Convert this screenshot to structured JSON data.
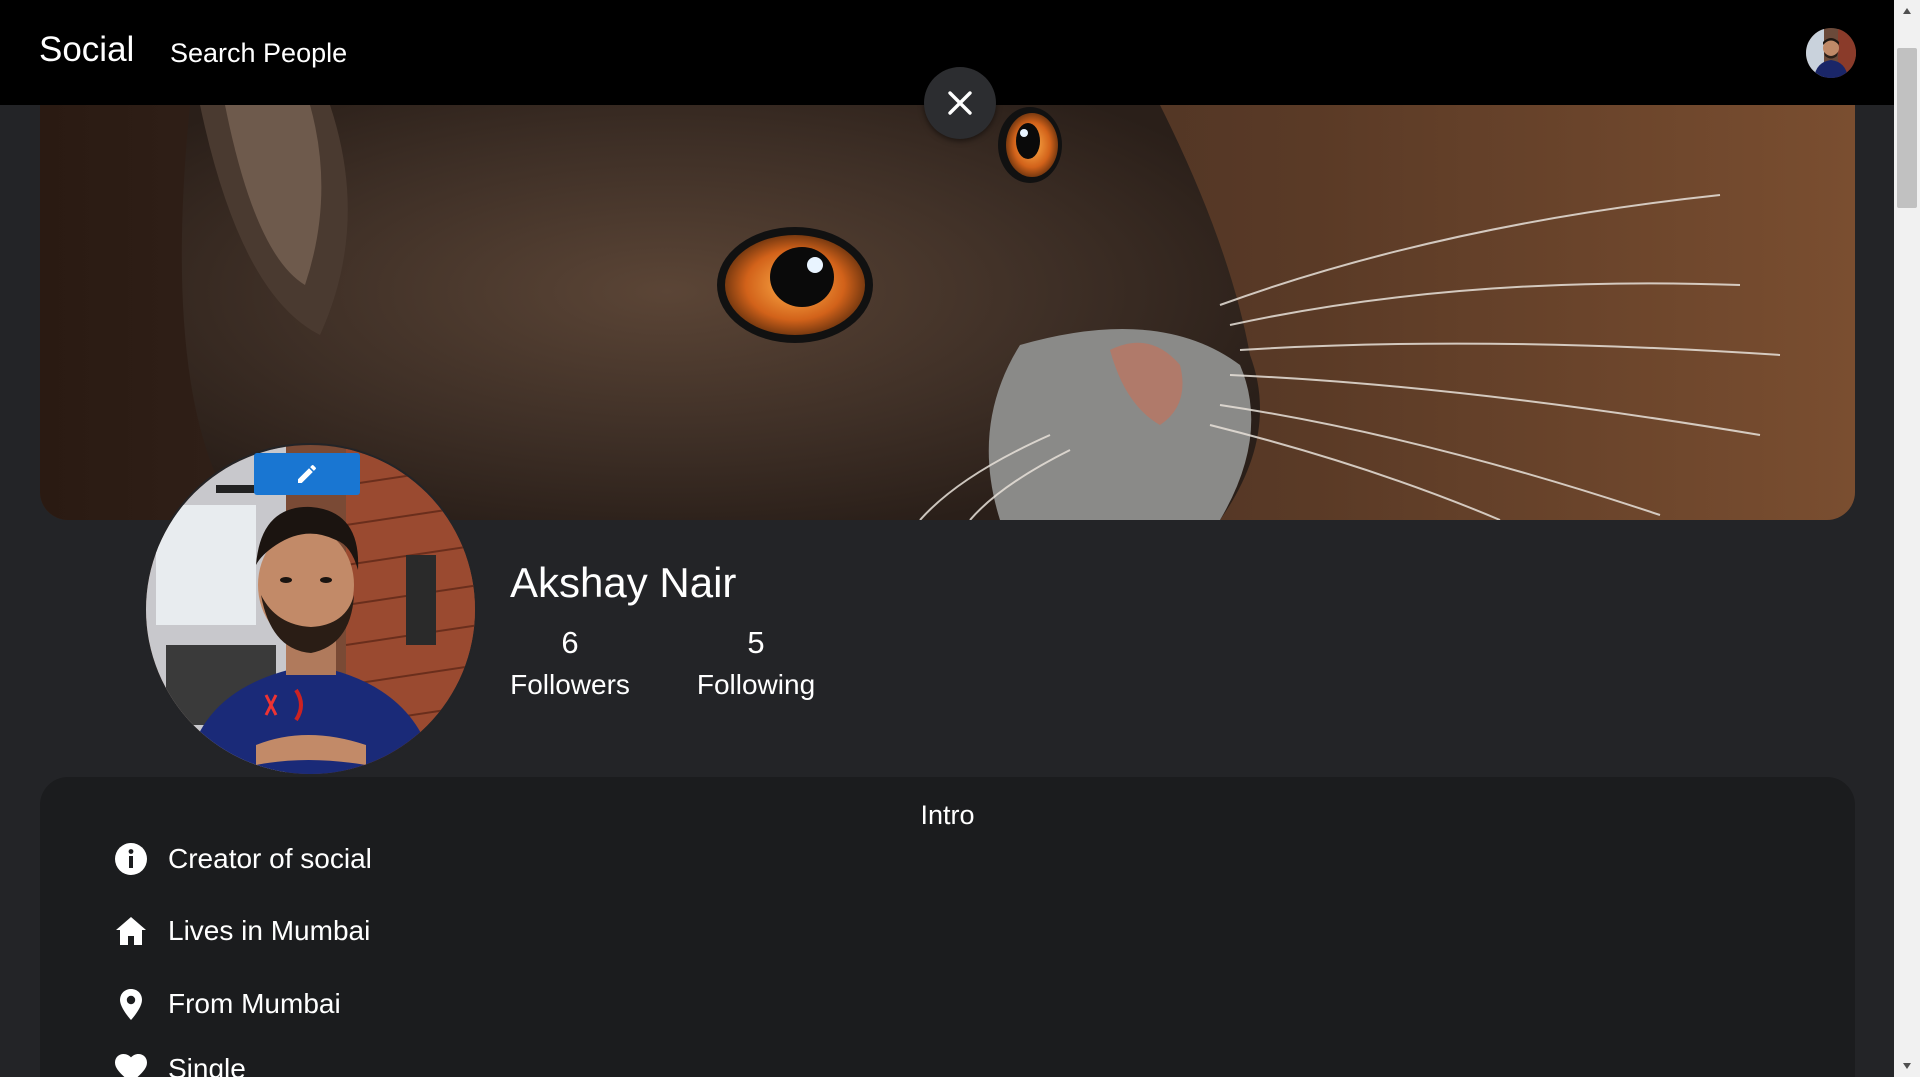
{
  "app": {
    "brand": "Social",
    "nav_search": "Search People"
  },
  "profile": {
    "name": "Akshay Nair",
    "followers_count": "6",
    "followers_label": "Followers",
    "following_count": "5",
    "following_label": "Following"
  },
  "intro": {
    "title": "Intro",
    "items": [
      {
        "icon": "info-icon",
        "text": "Creator of social"
      },
      {
        "icon": "home-icon",
        "text": "Lives in Mumbai"
      },
      {
        "icon": "location-pin-icon",
        "text": "From Mumbai"
      },
      {
        "icon": "heart-icon",
        "text": "Single"
      }
    ]
  },
  "colors": {
    "topbar": "#000000",
    "page_background": "#232427",
    "card_background": "#1b1c1e",
    "edit_button": "#1976d2"
  }
}
